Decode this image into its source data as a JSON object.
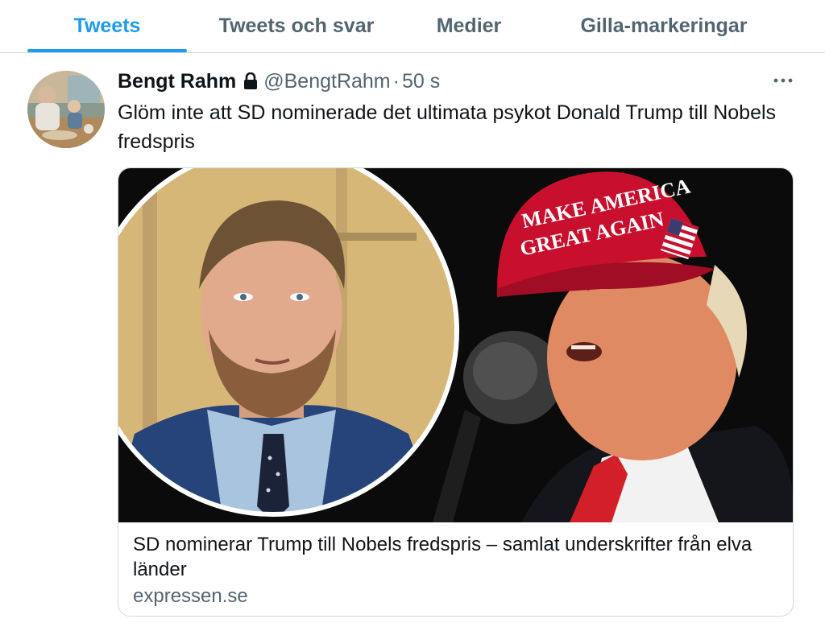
{
  "tabs": [
    {
      "label": "Tweets",
      "active": true
    },
    {
      "label": "Tweets och svar",
      "active": false
    },
    {
      "label": "Medier",
      "active": false
    },
    {
      "label": "Gilla-markeringar",
      "active": false
    }
  ],
  "tweet": {
    "author_name": "Bengt Rahm",
    "author_protected_icon": "lock-icon",
    "handle": "@BengtRahm",
    "separator": "·",
    "time": "50 s",
    "more_icon": "more-dots-icon",
    "text": "Glöm inte att SD nominerade det ultimata psykot Donald Trump till Nobels fredspris",
    "card": {
      "title": "SD nominerar Trump till Nobels fredspris – samlat underskrifter från elva länder",
      "domain": "expressen.se",
      "cap_text_line1": "MAKE AMERICA",
      "cap_text_line2": "GREAT AGAIN"
    }
  },
  "colors": {
    "accent": "#1d9bf0",
    "secondary_text": "#536471",
    "border": "#cfd9de",
    "cap_red": "#c8102e"
  }
}
